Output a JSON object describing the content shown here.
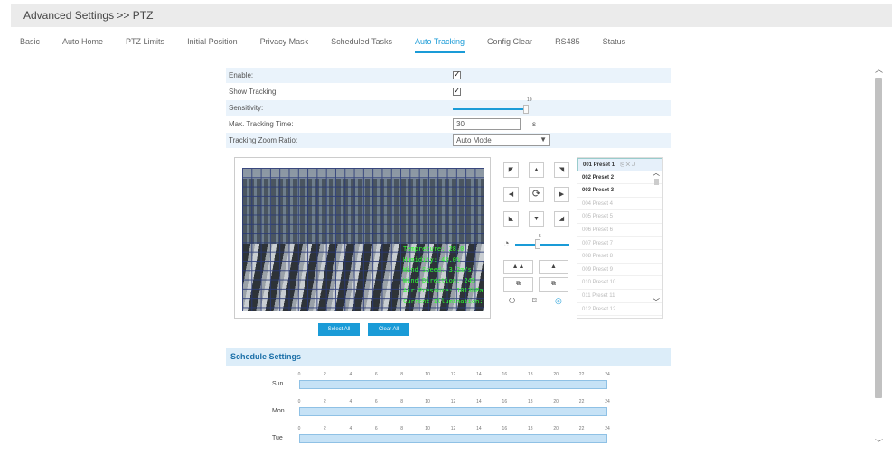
{
  "header": {
    "title": "Advanced Settings >> PTZ"
  },
  "tabs": [
    {
      "label": "Basic"
    },
    {
      "label": "Auto Home"
    },
    {
      "label": "PTZ Limits"
    },
    {
      "label": "Initial Position"
    },
    {
      "label": "Privacy Mask"
    },
    {
      "label": "Scheduled Tasks"
    },
    {
      "label": "Auto Tracking",
      "active": true
    },
    {
      "label": "Config Clear"
    },
    {
      "label": "RS485"
    },
    {
      "label": "Status"
    }
  ],
  "settings": {
    "enable_label": "Enable:",
    "enable_checked": true,
    "show_tracking_label": "Show Tracking:",
    "show_tracking_checked": true,
    "sensitivity_label": "Sensitivity:",
    "sensitivity_value": "10",
    "max_time_label": "Max. Tracking Time:",
    "max_time_value": "30",
    "max_time_unit": "s",
    "zoom_ratio_label": "Tracking Zoom Ratio:",
    "zoom_ratio_value": "Auto Mode"
  },
  "osd_text": "Tempreture: 28.0\nHumidity: 48.0%\nWind Speed: 3.2m/s\nWind Direction: 245\nAir Pressure: 1013hPa\nCurrent Illumination: 320",
  "ptz": {
    "zoom_value": "5"
  },
  "presets": [
    {
      "label": "001  Preset 1",
      "set": true,
      "selected": true
    },
    {
      "label": "002  Preset 2",
      "set": true
    },
    {
      "label": "003  Preset 3",
      "set": true
    },
    {
      "label": "004  Preset 4"
    },
    {
      "label": "005  Preset 5"
    },
    {
      "label": "006  Preset 6"
    },
    {
      "label": "007  Preset 7"
    },
    {
      "label": "008  Preset 8"
    },
    {
      "label": "009  Preset 9"
    },
    {
      "label": "010  Preset 10"
    },
    {
      "label": "011  Preset 11"
    },
    {
      "label": "012  Preset 12"
    }
  ],
  "buttons": {
    "select_all": "Select All",
    "clear_all": "Clear All"
  },
  "schedule": {
    "title": "Schedule Settings",
    "hours": [
      "0",
      "2",
      "4",
      "6",
      "8",
      "10",
      "12",
      "14",
      "16",
      "18",
      "20",
      "22",
      "24"
    ],
    "days": [
      "Sun",
      "Mon",
      "Tue"
    ]
  }
}
